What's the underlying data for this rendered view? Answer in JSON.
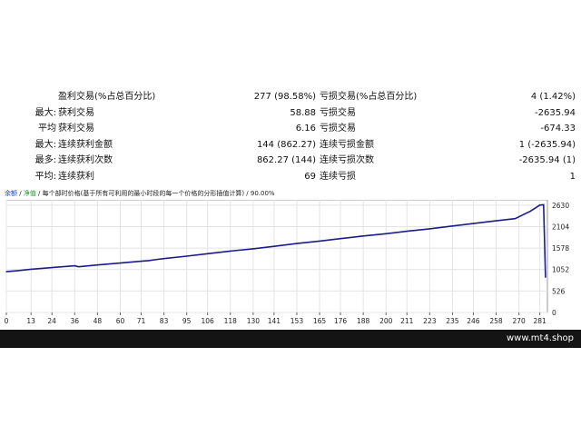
{
  "stats": {
    "rows": [
      {
        "label": "",
        "name1": "盈利交易(%占总百分比)",
        "value1": "277 (98.58%)",
        "name2": "亏损交易(%占总百分比)",
        "value2": "4 (1.42%)"
      },
      {
        "label": "最大:",
        "name1": "获利交易",
        "value1": "58.88",
        "name2": "亏损交易",
        "value2": "-2635.94"
      },
      {
        "label": "平均",
        "name1": "获利交易",
        "value1": "6.16",
        "name2": "亏损交易",
        "value2": "-674.33"
      },
      {
        "label": "最大:",
        "name1": "连续获利金额",
        "value1": "144 (862.27)",
        "name2": "连续亏损金额",
        "value2": "1 (-2635.94)"
      },
      {
        "label": "最多:",
        "name1": "连续获利次数",
        "value1": "862.27 (144)",
        "name2": "连续亏损次数",
        "value2": "-2635.94 (1)"
      },
      {
        "label": "平均:",
        "name1": "连续获利",
        "value1": "69",
        "name2": "连续亏损",
        "value2": "1"
      }
    ]
  },
  "chart_header": {
    "balance": "余额",
    "sep1": " / ",
    "equity": "净值",
    "sep2": " / ",
    "text": "每个部时价格(基于所有可利用的最小时段的每一个价格的分形插值计算) / 90.00%"
  },
  "chart_data": {
    "type": "line",
    "title": "",
    "xlabel": "",
    "ylabel": "",
    "y_axis_position": "right",
    "x_ticks": [
      "0",
      "13",
      "24",
      "36",
      "48",
      "60",
      "71",
      "83",
      "95",
      "106",
      "118",
      "130",
      "141",
      "153",
      "165",
      "176",
      "188",
      "200",
      "211",
      "223",
      "235",
      "246",
      "258",
      "270",
      "281"
    ],
    "y_ticks": [
      "2630",
      "2104",
      "1578",
      "1052",
      "526",
      "0"
    ],
    "xlim": [
      0,
      285
    ],
    "ylim": [
      0,
      2760
    ],
    "series": [
      {
        "name": "",
        "color": "#1c1c8c",
        "x": [
          0,
          5,
          13,
          24,
          36,
          38,
          48,
          60,
          71,
          75,
          78,
          83,
          95,
          106,
          118,
          130,
          141,
          153,
          165,
          176,
          188,
          200,
          211,
          223,
          235,
          246,
          258,
          268,
          276,
          281,
          283,
          284
        ],
        "y": [
          1000,
          1020,
          1060,
          1100,
          1145,
          1120,
          1165,
          1210,
          1255,
          1270,
          1290,
          1320,
          1380,
          1440,
          1505,
          1560,
          1620,
          1690,
          1750,
          1810,
          1875,
          1930,
          1990,
          2050,
          2120,
          2180,
          2245,
          2300,
          2480,
          2630,
          2640,
          860
        ]
      }
    ]
  },
  "footer": {
    "site": "www.mt4.shop"
  },
  "colors": {
    "line": "#1c1c8c",
    "footer_bg": "#141414"
  }
}
